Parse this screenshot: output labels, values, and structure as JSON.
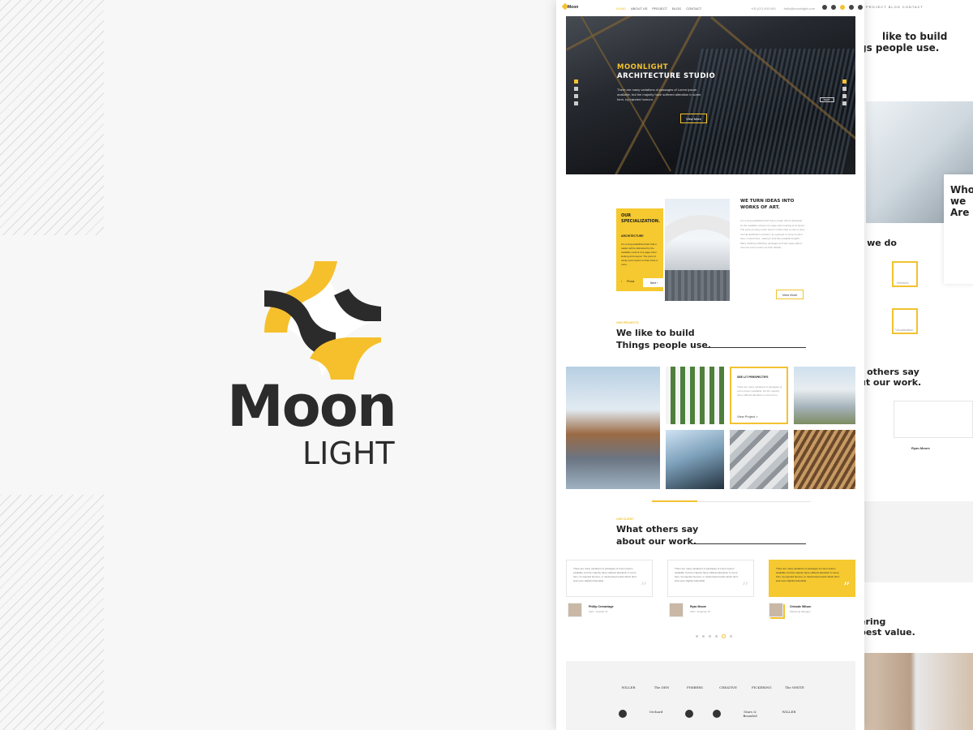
{
  "logo": {
    "word": "Moon",
    "sub": "LIGHT",
    "colors": {
      "accent": "#f5c02c",
      "dark": "#2b2b2b"
    }
  },
  "page": {
    "brand": "Moon",
    "menu": [
      "HOME",
      "ABOUT US",
      "PROJECT",
      "BLOG",
      "CONTACT"
    ],
    "contact": [
      "+00 (07) 000 000",
      "hello@moonlight.com"
    ],
    "hero": {
      "title1": "MOONLIGHT",
      "title2": "ARCHITECTURE STUDIO",
      "text": "There are many variations of passages of Lorem Ipsum available, but the majority have suffered alteration in some form, by injected humour.",
      "button": "View More",
      "side_button": "NEXT"
    },
    "spec": {
      "title": "OUR SPECIALIZATION.",
      "subtitle": "ARCHITECTURE",
      "text": "It is a long established fact that a reader will be distracted by the readable content of a page when looking at its layout. The point of using Lorem Ipsum is that it has a more.",
      "prev": "Prova",
      "next": "Next"
    },
    "ideas": {
      "title": "WE TURN IDEAS INTO WORKS OF ART.",
      "text": "It is a long established fact that a reader will be distracted by the readable content of a page when looking at its layout. The point of using Lorem Ipsum is that it has a more-or-less normal distribution of letters, as opposed to using Content here, content here, making it look like readable English. Many desktop publishing packages and web page editors now use Lorem Ipsum as their default.",
      "button": "View More"
    },
    "projects": {
      "label": "OUR PROJECTS",
      "title1": "We like to build",
      "title2": "Things people use.",
      "card_title": "SEE LIT PERSPECTIFS",
      "card_text": "There are many variations of passages of Lorem Ipsum available, but the majority have suffered alteration in some form.",
      "card_link": "View Project  >"
    },
    "clients": {
      "label": "OUR CLIENT",
      "title1": "What others say",
      "title2": "about our work.",
      "quotes": [
        "There are many variations of passages of Lorem Ipsum available, but the majority have suffered alteration in some form, by injected humour, or randomised words which don't look even slightly believable.",
        "There are many variations of passages of Lorem Ipsum available, but the majority have suffered alteration in some form, by injected humour, or randomised words which don't look even slightly believable.",
        "There are many variations of passages of Lorem Ipsum available, but the majority have suffered alteration in some form, by injected humour, or randomised words which don't look even slightly believable."
      ],
      "people": [
        {
          "name": "Phillip Cervantage",
          "role": "CEO - Graphic W"
        },
        {
          "name": "Ryan Moore",
          "role": "CEO - Engineer W"
        },
        {
          "name": "Chinode Wilson",
          "role": "Marketing Manager"
        }
      ]
    },
    "logos_row1": [
      "WILLER",
      "The DEN",
      "FIMBERS",
      "CREATIVE",
      "PICKERING",
      "The WHITE",
      "WILLER"
    ],
    "logos_row2": [
      "",
      "Orchard",
      "",
      "",
      "Stars & Branded",
      "WILLER"
    ]
  },
  "back_page": {
    "menu": "PROJECT   BLOG   CONTACT",
    "h1": "like to build",
    "h2": "gs people use.",
    "who1": "Who",
    "who2": "we",
    "who3": "Are",
    "what": "t we do",
    "svc1": "Interiors",
    "svc2": "Visualization",
    "others1": "t others say",
    "others2": "ut our work.",
    "person": "Ryan Moore",
    "offer1": "ering",
    "offer2": "best value."
  }
}
